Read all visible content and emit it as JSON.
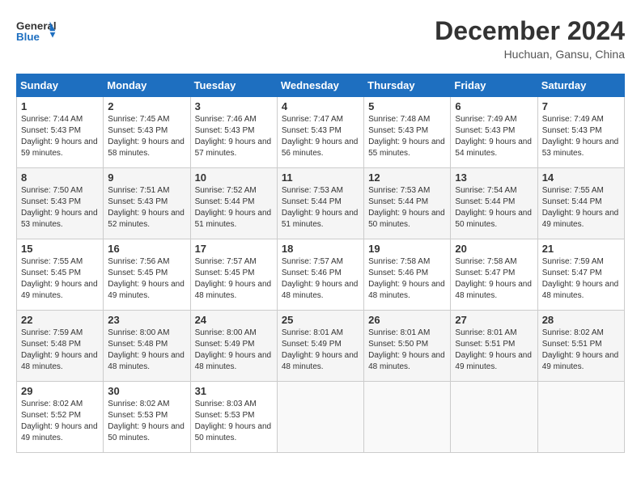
{
  "header": {
    "logo_general": "General",
    "logo_blue": "Blue",
    "month_title": "December 2024",
    "location": "Huchuan, Gansu, China"
  },
  "weekdays": [
    "Sunday",
    "Monday",
    "Tuesday",
    "Wednesday",
    "Thursday",
    "Friday",
    "Saturday"
  ],
  "weeks": [
    [
      {
        "day": 1,
        "sunrise": "7:44 AM",
        "sunset": "5:43 PM",
        "daylight": "9 hours and 59 minutes."
      },
      {
        "day": 2,
        "sunrise": "7:45 AM",
        "sunset": "5:43 PM",
        "daylight": "9 hours and 58 minutes."
      },
      {
        "day": 3,
        "sunrise": "7:46 AM",
        "sunset": "5:43 PM",
        "daylight": "9 hours and 57 minutes."
      },
      {
        "day": 4,
        "sunrise": "7:47 AM",
        "sunset": "5:43 PM",
        "daylight": "9 hours and 56 minutes."
      },
      {
        "day": 5,
        "sunrise": "7:48 AM",
        "sunset": "5:43 PM",
        "daylight": "9 hours and 55 minutes."
      },
      {
        "day": 6,
        "sunrise": "7:49 AM",
        "sunset": "5:43 PM",
        "daylight": "9 hours and 54 minutes."
      },
      {
        "day": 7,
        "sunrise": "7:49 AM",
        "sunset": "5:43 PM",
        "daylight": "9 hours and 53 minutes."
      }
    ],
    [
      {
        "day": 8,
        "sunrise": "7:50 AM",
        "sunset": "5:43 PM",
        "daylight": "9 hours and 53 minutes."
      },
      {
        "day": 9,
        "sunrise": "7:51 AM",
        "sunset": "5:43 PM",
        "daylight": "9 hours and 52 minutes."
      },
      {
        "day": 10,
        "sunrise": "7:52 AM",
        "sunset": "5:44 PM",
        "daylight": "9 hours and 51 minutes."
      },
      {
        "day": 11,
        "sunrise": "7:53 AM",
        "sunset": "5:44 PM",
        "daylight": "9 hours and 51 minutes."
      },
      {
        "day": 12,
        "sunrise": "7:53 AM",
        "sunset": "5:44 PM",
        "daylight": "9 hours and 50 minutes."
      },
      {
        "day": 13,
        "sunrise": "7:54 AM",
        "sunset": "5:44 PM",
        "daylight": "9 hours and 50 minutes."
      },
      {
        "day": 14,
        "sunrise": "7:55 AM",
        "sunset": "5:44 PM",
        "daylight": "9 hours and 49 minutes."
      }
    ],
    [
      {
        "day": 15,
        "sunrise": "7:55 AM",
        "sunset": "5:45 PM",
        "daylight": "9 hours and 49 minutes."
      },
      {
        "day": 16,
        "sunrise": "7:56 AM",
        "sunset": "5:45 PM",
        "daylight": "9 hours and 49 minutes."
      },
      {
        "day": 17,
        "sunrise": "7:57 AM",
        "sunset": "5:45 PM",
        "daylight": "9 hours and 48 minutes."
      },
      {
        "day": 18,
        "sunrise": "7:57 AM",
        "sunset": "5:46 PM",
        "daylight": "9 hours and 48 minutes."
      },
      {
        "day": 19,
        "sunrise": "7:58 AM",
        "sunset": "5:46 PM",
        "daylight": "9 hours and 48 minutes."
      },
      {
        "day": 20,
        "sunrise": "7:58 AM",
        "sunset": "5:47 PM",
        "daylight": "9 hours and 48 minutes."
      },
      {
        "day": 21,
        "sunrise": "7:59 AM",
        "sunset": "5:47 PM",
        "daylight": "9 hours and 48 minutes."
      }
    ],
    [
      {
        "day": 22,
        "sunrise": "7:59 AM",
        "sunset": "5:48 PM",
        "daylight": "9 hours and 48 minutes."
      },
      {
        "day": 23,
        "sunrise": "8:00 AM",
        "sunset": "5:48 PM",
        "daylight": "9 hours and 48 minutes."
      },
      {
        "day": 24,
        "sunrise": "8:00 AM",
        "sunset": "5:49 PM",
        "daylight": "9 hours and 48 minutes."
      },
      {
        "day": 25,
        "sunrise": "8:01 AM",
        "sunset": "5:49 PM",
        "daylight": "9 hours and 48 minutes."
      },
      {
        "day": 26,
        "sunrise": "8:01 AM",
        "sunset": "5:50 PM",
        "daylight": "9 hours and 48 minutes."
      },
      {
        "day": 27,
        "sunrise": "8:01 AM",
        "sunset": "5:51 PM",
        "daylight": "9 hours and 49 minutes."
      },
      {
        "day": 28,
        "sunrise": "8:02 AM",
        "sunset": "5:51 PM",
        "daylight": "9 hours and 49 minutes."
      }
    ],
    [
      {
        "day": 29,
        "sunrise": "8:02 AM",
        "sunset": "5:52 PM",
        "daylight": "9 hours and 49 minutes."
      },
      {
        "day": 30,
        "sunrise": "8:02 AM",
        "sunset": "5:53 PM",
        "daylight": "9 hours and 50 minutes."
      },
      {
        "day": 31,
        "sunrise": "8:03 AM",
        "sunset": "5:53 PM",
        "daylight": "9 hours and 50 minutes."
      },
      null,
      null,
      null,
      null
    ]
  ]
}
